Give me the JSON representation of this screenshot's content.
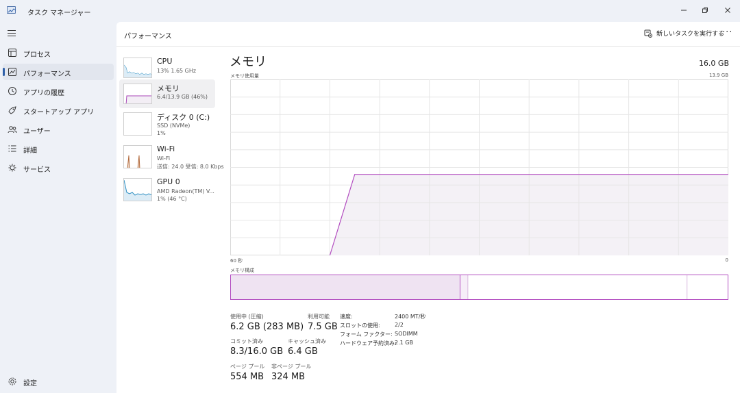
{
  "window": {
    "title": "タスク マネージャー",
    "icons": {
      "app": "task-manager-icon",
      "minimize": "minimize-icon",
      "maximize": "restore-icon",
      "close": "close-icon"
    }
  },
  "nav": {
    "items": [
      {
        "label": "プロセス",
        "icon": "processes-icon"
      },
      {
        "label": "パフォーマンス",
        "icon": "performance-icon",
        "active": true
      },
      {
        "label": "アプリの履歴",
        "icon": "history-icon"
      },
      {
        "label": "スタートアップ アプリ",
        "icon": "startup-icon"
      },
      {
        "label": "ユーザー",
        "icon": "users-icon"
      },
      {
        "label": "詳細",
        "icon": "details-icon"
      },
      {
        "label": "サービス",
        "icon": "services-icon"
      }
    ],
    "settings": {
      "label": "設定",
      "icon": "gear-icon"
    }
  },
  "header": {
    "title": "パフォーマンス",
    "run_task_label": "新しいタスクを実行する",
    "more": "···"
  },
  "perf_list": [
    {
      "name": "CPU",
      "sub1": "13% 1.65 GHz",
      "sub2": ""
    },
    {
      "name": "メモリ",
      "sub1": "6.4/13.9 GB (46%)",
      "sub2": "",
      "active": true
    },
    {
      "name": "ディスク 0 (C:)",
      "sub1": "SSD (NVMe)",
      "sub2": "1%"
    },
    {
      "name": "Wi-Fi",
      "sub1": "Wi-Fi",
      "sub2": "送信: 24.0 受信: 8.0 Kbps"
    },
    {
      "name": "GPU 0",
      "sub1": "AMD Radeon(TM) V...",
      "sub2": "1% (46 °C)"
    }
  ],
  "detail": {
    "title": "メモリ",
    "total": "16.0 GB",
    "usage_label": "メモリ使用量",
    "usage_max": "13.9 GB",
    "axis_left": "60 秒",
    "axis_right": "0",
    "composition_label": "メモリ構成",
    "stats": {
      "in_use_label": "使用中 (圧縮)",
      "in_use_value": "6.2 GB (283 MB)",
      "available_label": "利用可能",
      "available_value": "7.5 GB",
      "committed_label": "コミット済み",
      "committed_value": "8.3/16.0 GB",
      "cached_label": "キャッシュ済み",
      "cached_value": "6.4 GB",
      "paged_label": "ページ プール",
      "paged_value": "554 MB",
      "nonpaged_label": "非ページ プール",
      "nonpaged_value": "324 MB"
    },
    "specs": [
      {
        "key": "速度:",
        "value": "2400 MT/秒"
      },
      {
        "key": "スロットの使用:",
        "value": "2/2"
      },
      {
        "key": "フォーム ファクター:",
        "value": "SODIMM"
      },
      {
        "key": "ハードウェア予約済み:",
        "value": "2.1 GB"
      }
    ]
  },
  "chart_data": {
    "type": "area",
    "xlabel": "",
    "ylabel": "",
    "x": [
      60,
      57,
      54,
      51,
      48,
      45,
      42,
      39,
      36,
      33,
      30,
      27,
      24,
      21,
      18,
      15,
      12,
      9,
      6,
      3,
      0
    ],
    "xlim": [
      60,
      0
    ],
    "ylim": [
      0,
      13.9
    ],
    "series": [
      {
        "values": [
          null,
          null,
          null,
          null,
          0,
          6.4,
          6.4,
          6.4,
          6.4,
          6.4,
          6.4,
          6.4,
          6.4,
          6.4,
          6.4,
          6.4,
          6.4,
          6.4,
          6.4,
          6.4,
          6.4
        ]
      }
    ],
    "grid": true,
    "colors": {
      "line": "#b24cc0",
      "fill": "#f4f1f6",
      "grid": "#e6e6e6"
    },
    "composition": {
      "in_use_fraction": 0.46,
      "modified_fraction": 0.015,
      "standby_fraction": 0.44,
      "free_fraction": 0.085
    }
  }
}
